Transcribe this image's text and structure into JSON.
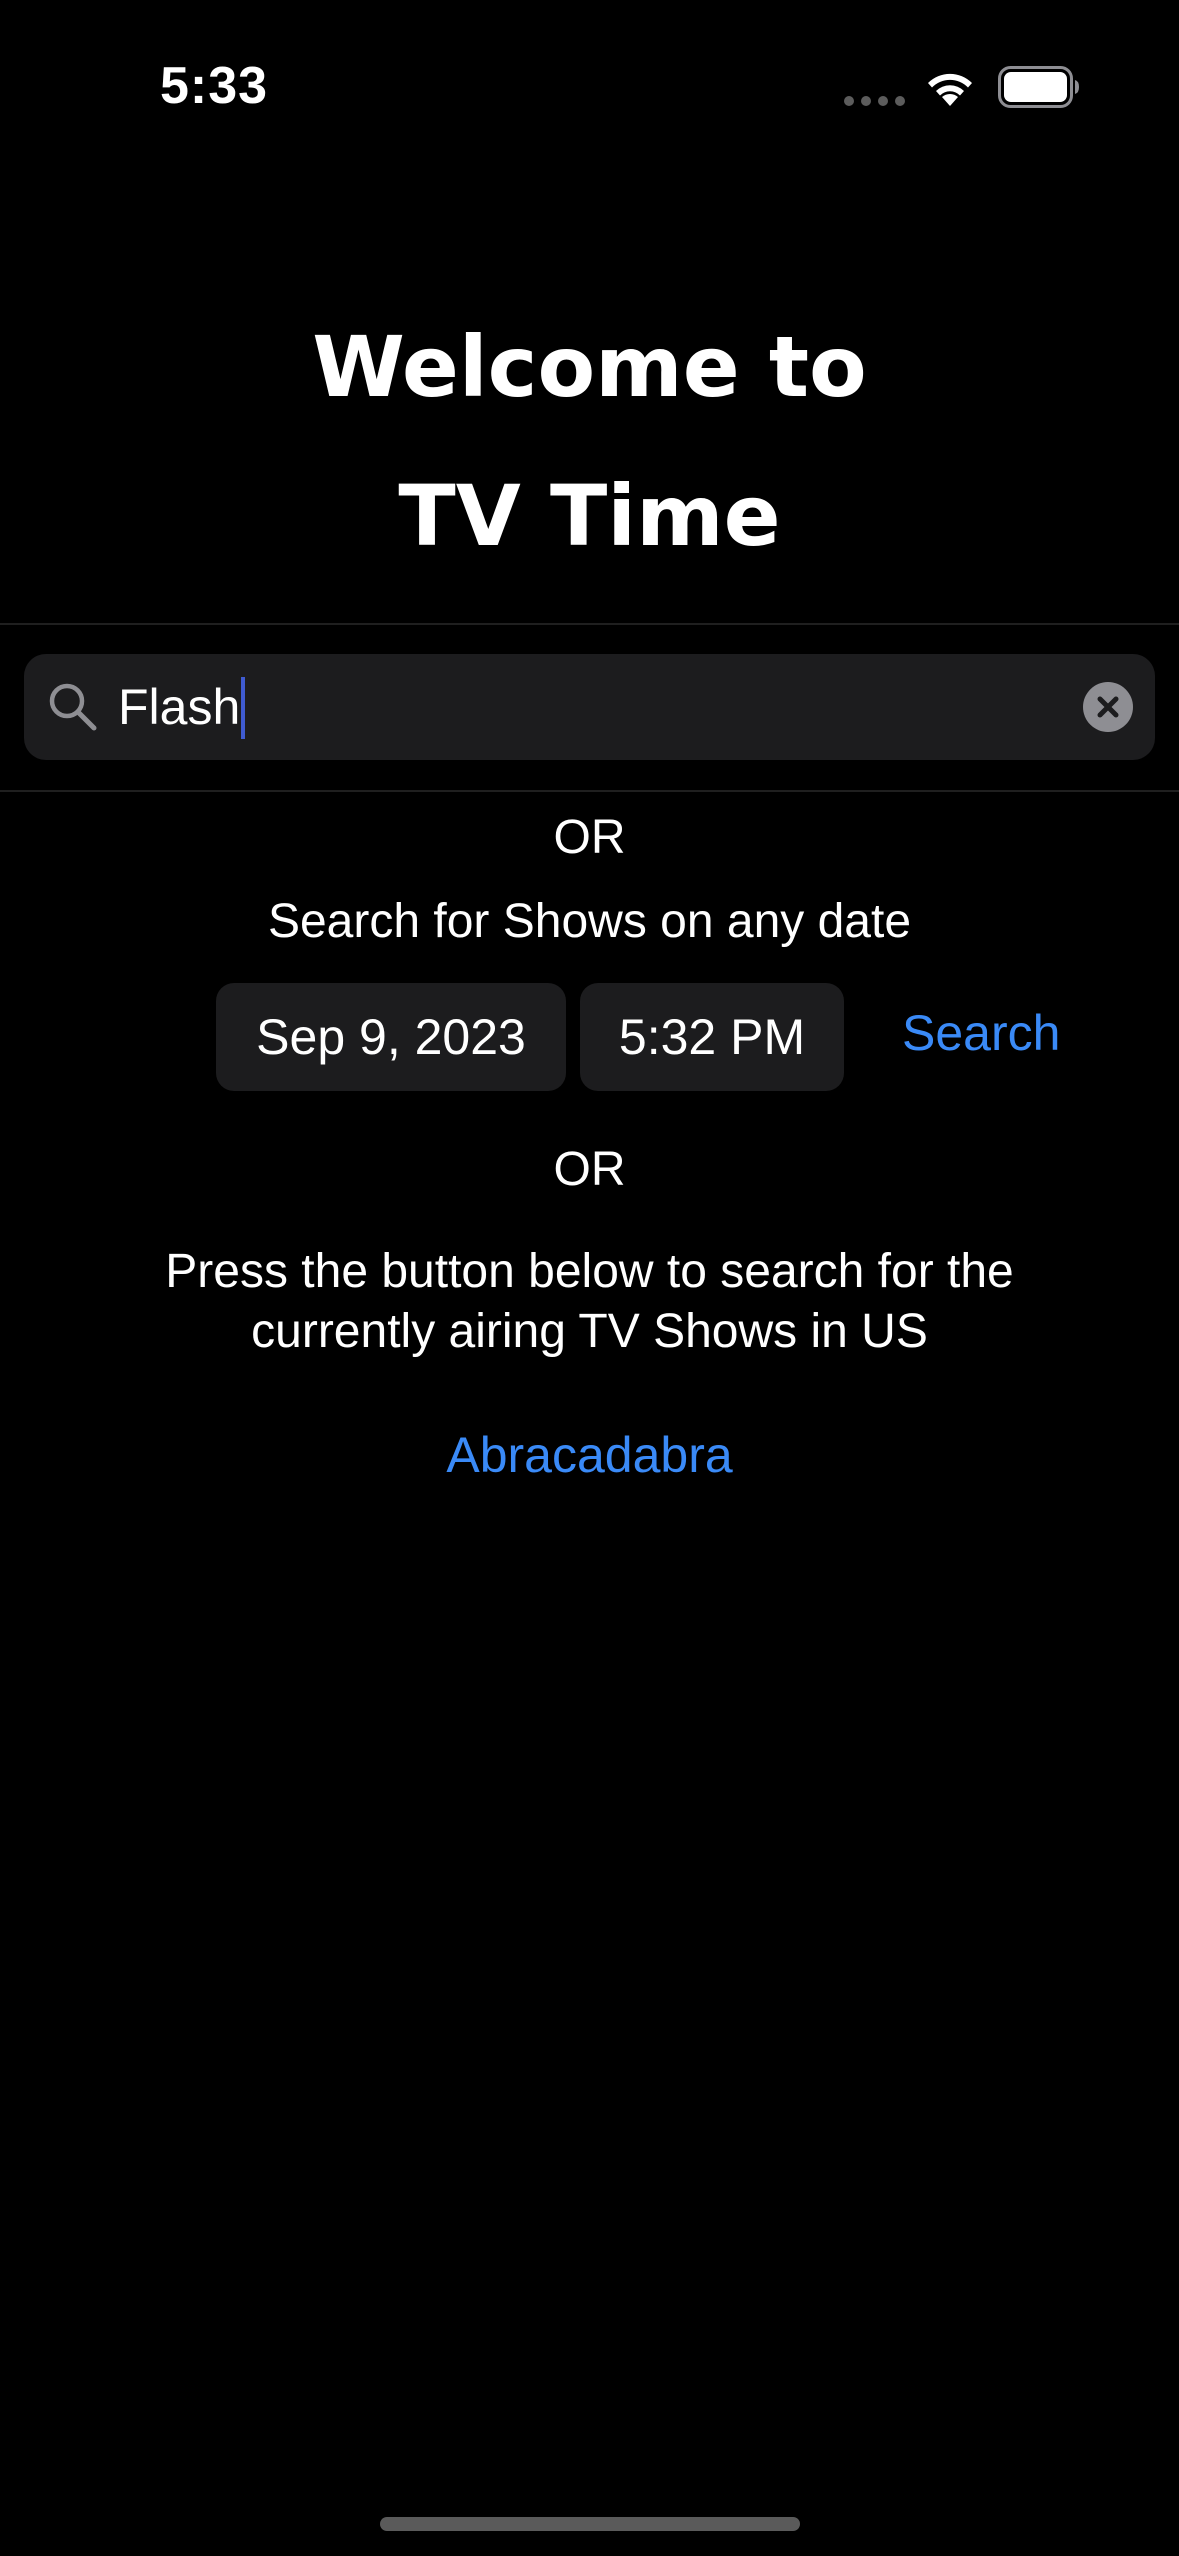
{
  "status_bar": {
    "time": "5:33",
    "icons": [
      "cellular-signal-icon",
      "wifi-icon",
      "battery-icon"
    ]
  },
  "header": {
    "title_line_1": "Welcome to",
    "title_line_2": "TV Time"
  },
  "search": {
    "value": "Flash",
    "icon": "magnifying-glass-icon",
    "clear_icon": "clear-x-icon"
  },
  "main": {
    "or_1": "OR",
    "date_search_label": "Search for Shows on any date",
    "date_value": "Sep 9, 2023",
    "time_value": "5:32 PM",
    "search_button": "Search",
    "or_2": "OR",
    "description": "Press the button below to search for the currently airing TV Shows in US",
    "abracadabra_button": "Abracadabra"
  },
  "colors": {
    "background": "#000000",
    "field_background": "#1c1c1e",
    "accent": "#3a8af7",
    "caret": "#3f5bd1"
  }
}
